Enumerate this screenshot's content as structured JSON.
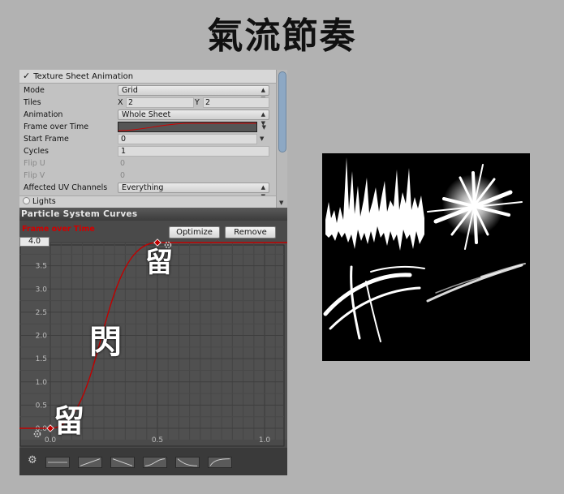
{
  "page": {
    "title": "氣流節奏"
  },
  "inspector": {
    "module_title": "Texture Sheet Animation",
    "module_check": "✓",
    "rows": [
      {
        "label": "Mode",
        "value": "Grid",
        "kind": "dropdown"
      },
      {
        "label": "Tiles",
        "kind": "xy",
        "x_label": "X",
        "x_value": "2",
        "y_label": "Y",
        "y_value": "2"
      },
      {
        "label": "Animation",
        "value": "Whole Sheet",
        "kind": "dropdown"
      },
      {
        "label": "Frame over Time",
        "kind": "curve"
      },
      {
        "label": "Start Frame",
        "value": "0",
        "kind": "number-dropdown"
      },
      {
        "label": "Cycles",
        "value": "1",
        "kind": "number"
      },
      {
        "label": "Flip U",
        "value": "0",
        "kind": "disabled"
      },
      {
        "label": "Flip V",
        "value": "0",
        "kind": "disabled"
      },
      {
        "label": "Affected UV Channels",
        "value": "Everything",
        "kind": "dropdown"
      }
    ],
    "next_module": "Lights"
  },
  "curves_panel": {
    "title": "Particle System Curves",
    "curve_name": "Frame over Time",
    "optimize_label": "Optimize",
    "remove_label": "Remove",
    "y_max_field": "4.0",
    "y_ticks": [
      "3.5",
      "3.0",
      "2.5",
      "2.0",
      "1.5",
      "1.0",
      "0.5",
      "0.0"
    ],
    "x_ticks": [
      "0.0",
      "0.5",
      "1.0"
    ],
    "curve_color": "#c00000",
    "keys": [
      {
        "t": 0.0,
        "v": 0.0
      },
      {
        "t": 0.5,
        "v": 4.0
      }
    ],
    "annotations": {
      "hold_top": "留",
      "flash": "閃",
      "hold_bottom": "留"
    },
    "preset_count": 6
  },
  "colors": {
    "background": "#b2b2b2",
    "accent_red": "#d20000",
    "scroll_thumb": "#8da8c4"
  }
}
